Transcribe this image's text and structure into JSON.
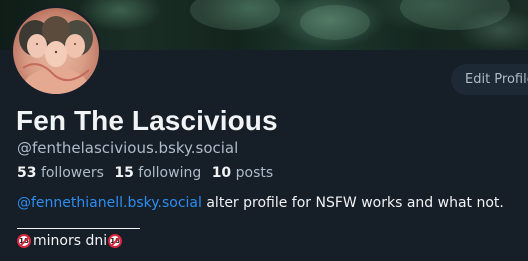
{
  "profile": {
    "display_name": "Fen The Lascivious",
    "handle": "@fenthelascivious.bsky.social",
    "edit_button_label": "Edit Profile",
    "stats": {
      "followers_count": "53",
      "followers_label": "followers",
      "following_count": "15",
      "following_label": "following",
      "posts_count": "10",
      "posts_label": "posts"
    },
    "bio": {
      "mention": "@fennethianell.bsky.social",
      "text": " alter profile for NSFW works and what not.",
      "line2_text": "minors dni",
      "badge_label": "18"
    }
  },
  "colors": {
    "background": "#161e27",
    "text_primary": "#f1f3f5",
    "text_secondary": "#aebbc9",
    "link": "#2c8ef2",
    "button_bg": "#1e2936"
  },
  "icons": {
    "badge": "no-under-18-icon"
  }
}
